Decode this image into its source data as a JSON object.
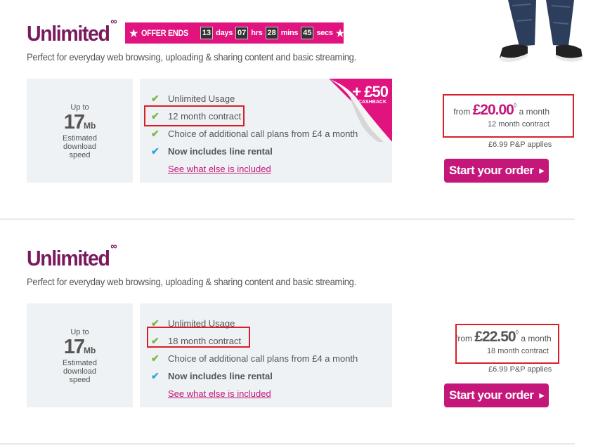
{
  "colors": {
    "brand_purple": "#7a1a5e",
    "brand_pink": "#e0137f",
    "button_pink": "#c5177a",
    "panel_bg": "#eef2f5",
    "tick_green": "#7ab648",
    "tick_blue": "#2ba8d8",
    "highlight_red": "#d9202a"
  },
  "offer": {
    "prefix": "OFFER ENDS",
    "days": "13",
    "days_label": "days",
    "hrs": "07",
    "hrs_label": "hrs",
    "mins": "28",
    "mins_label": "mins",
    "secs": "45",
    "secs_label": "secs"
  },
  "plans": [
    {
      "title": "Unlimited",
      "title_mark": "∞",
      "description": "Perfect for everyday web browsing, uploading & sharing content and basic streaming.",
      "speed": {
        "upto": "Up to",
        "value": "17",
        "unit": "Mb",
        "label": "Estimated download speed"
      },
      "features": [
        {
          "text": "Unlimited Usage",
          "icon": "check-icon"
        },
        {
          "text": "12 month contract",
          "icon": "check-icon"
        },
        {
          "text": "Choice of additional call plans from £4 a month",
          "icon": "check-icon"
        },
        {
          "text": "Now includes line rental",
          "icon": "check-icon"
        }
      ],
      "more_link": "See what else is included",
      "cashback": {
        "amount": "+ £50",
        "label": "CASHBACK"
      },
      "price": {
        "from": "from",
        "amount": "£20.00",
        "dagger": "◊",
        "period": "a month",
        "term": "12 month contract",
        "pp": "£6.99 P&P applies"
      },
      "order_label": "Start your order"
    },
    {
      "title": "Unlimited",
      "title_mark": "∞",
      "description": "Perfect for everyday web browsing, uploading & sharing content and basic streaming.",
      "speed": {
        "upto": "Up to",
        "value": "17",
        "unit": "Mb",
        "label": "Estimated download speed"
      },
      "features": [
        {
          "text": "Unlimited Usage",
          "icon": "check-icon"
        },
        {
          "text": "18 month contract",
          "icon": "check-icon"
        },
        {
          "text": "Choice of additional call plans from £4 a month",
          "icon": "check-icon"
        },
        {
          "text": "Now includes line rental",
          "icon": "check-icon"
        }
      ],
      "more_link": "See what else is included",
      "price": {
        "from": "from",
        "amount": "£22.50",
        "dagger": "◊",
        "period": "a month",
        "term": "18 month contract",
        "pp": "£6.99 P&P applies"
      },
      "order_label": "Start your order"
    }
  ]
}
